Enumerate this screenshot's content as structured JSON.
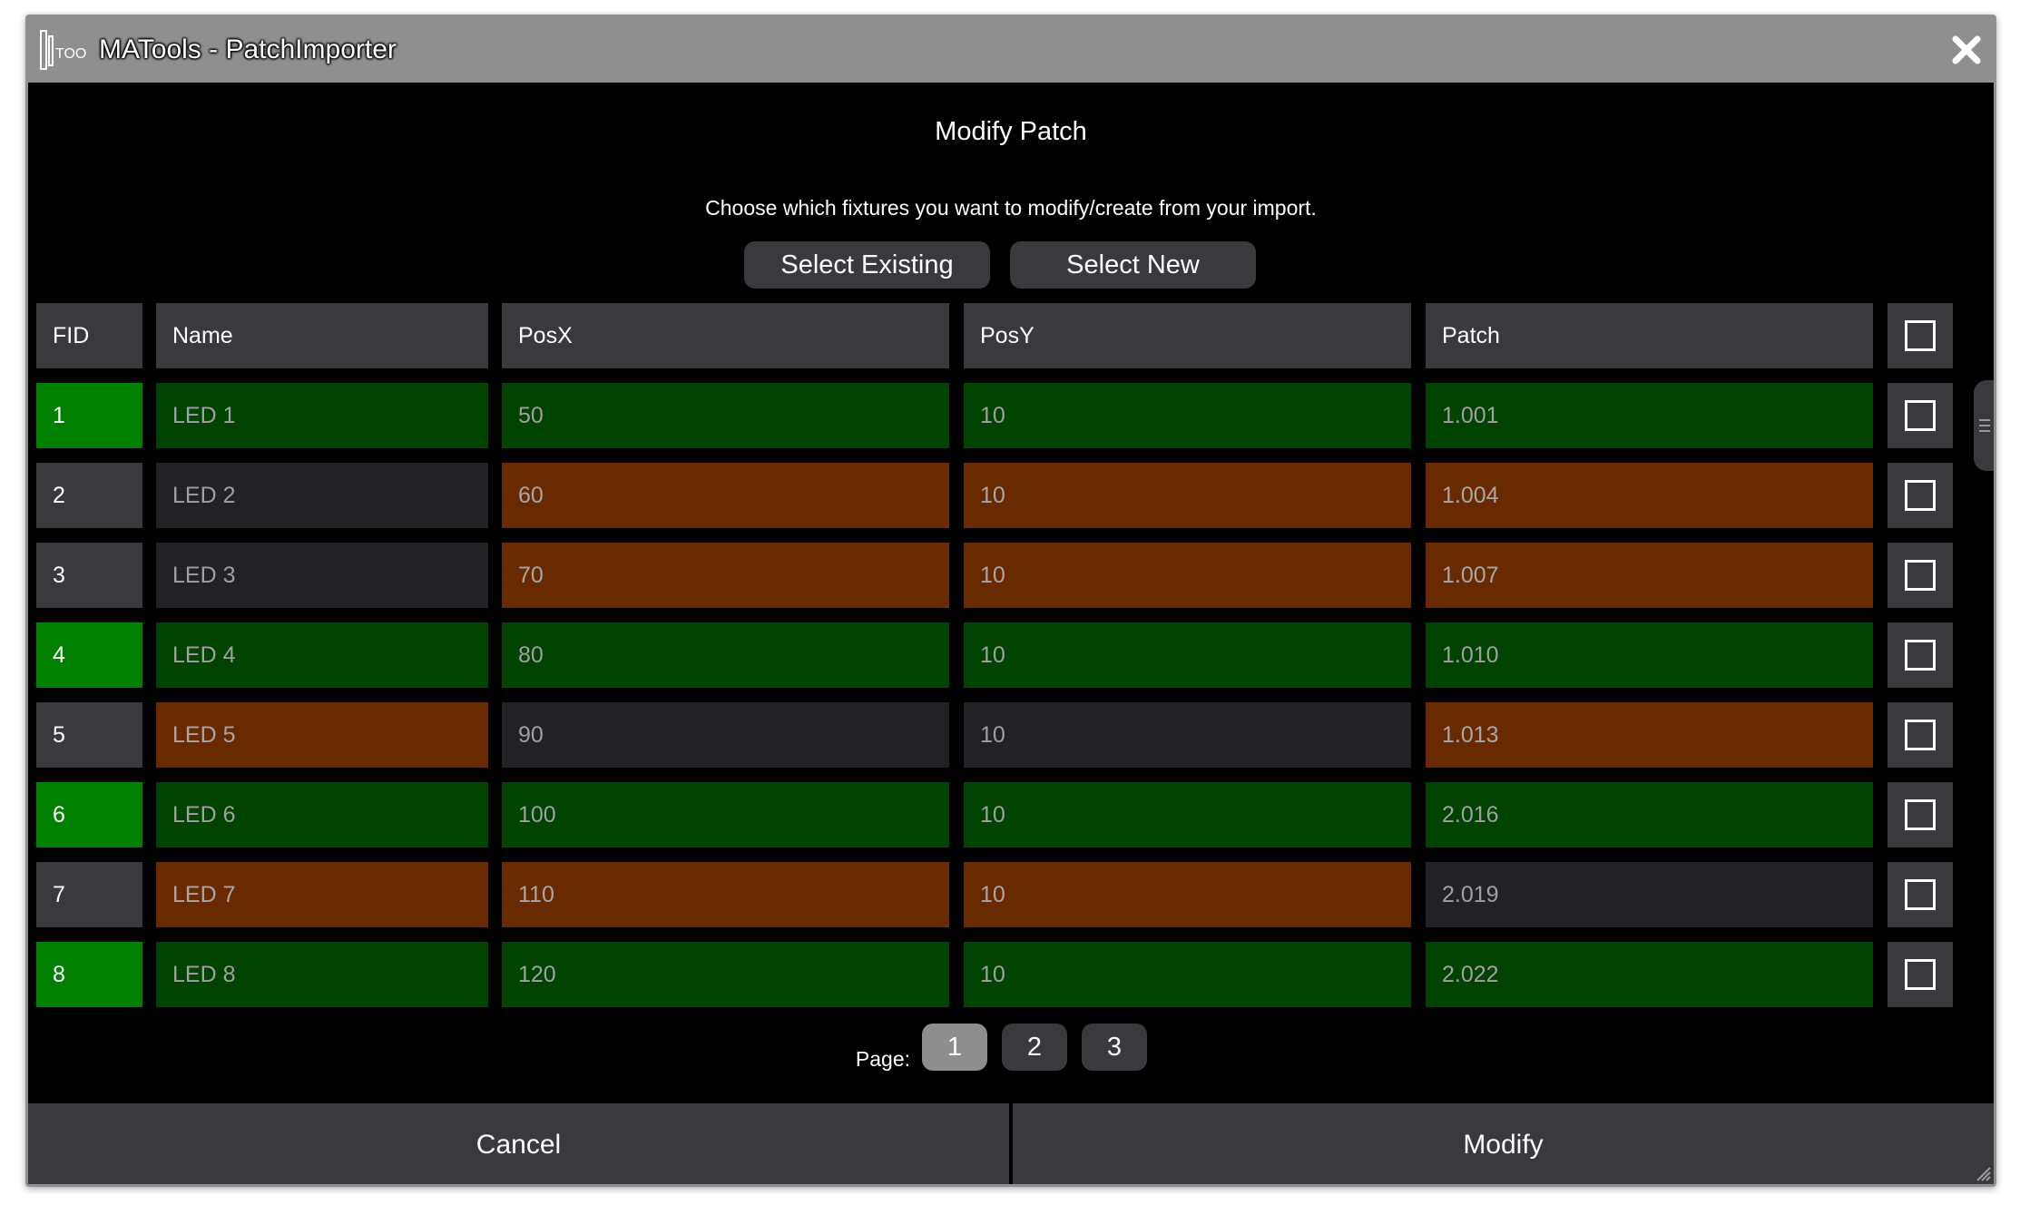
{
  "window": {
    "title": "MATools - PatchImporter"
  },
  "dialog": {
    "title": "Modify Patch",
    "subtitle": "Choose which fixtures you want to modify/create from your import.",
    "select_existing_label": "Select Existing",
    "select_new_label": "Select New"
  },
  "table": {
    "headers": [
      "FID",
      "Name",
      "PosX",
      "PosY",
      "Patch"
    ],
    "rows": [
      {
        "fid": "1",
        "name": "LED 1",
        "posx": "50",
        "posy": "10",
        "patch": "1.001",
        "status": {
          "fid": "new",
          "name": "new",
          "posx": "new",
          "posy": "new",
          "patch": "new"
        }
      },
      {
        "fid": "2",
        "name": "LED 2",
        "posx": "60",
        "posy": "10",
        "patch": "1.004",
        "status": {
          "fid": "existing",
          "name": "same",
          "posx": "changed",
          "posy": "changed",
          "patch": "changed"
        }
      },
      {
        "fid": "3",
        "name": "LED 3",
        "posx": "70",
        "posy": "10",
        "patch": "1.007",
        "status": {
          "fid": "existing",
          "name": "same",
          "posx": "changed",
          "posy": "changed",
          "patch": "changed"
        }
      },
      {
        "fid": "4",
        "name": "LED 4",
        "posx": "80",
        "posy": "10",
        "patch": "1.010",
        "status": {
          "fid": "new",
          "name": "new",
          "posx": "new",
          "posy": "new",
          "patch": "new"
        }
      },
      {
        "fid": "5",
        "name": "LED 5",
        "posx": "90",
        "posy": "10",
        "patch": "1.013",
        "status": {
          "fid": "existing",
          "name": "changed",
          "posx": "same",
          "posy": "same",
          "patch": "changed"
        }
      },
      {
        "fid": "6",
        "name": "LED 6",
        "posx": "100",
        "posy": "10",
        "patch": "2.016",
        "status": {
          "fid": "new",
          "name": "new",
          "posx": "new",
          "posy": "new",
          "patch": "new"
        }
      },
      {
        "fid": "7",
        "name": "LED 7",
        "posx": "110",
        "posy": "10",
        "patch": "2.019",
        "status": {
          "fid": "existing",
          "name": "changed",
          "posx": "changed",
          "posy": "changed",
          "patch": "same"
        }
      },
      {
        "fid": "8",
        "name": "LED 8",
        "posx": "120",
        "posy": "10",
        "patch": "2.022",
        "status": {
          "fid": "new",
          "name": "new",
          "posx": "new",
          "posy": "new",
          "patch": "new"
        }
      }
    ]
  },
  "pagination": {
    "label": "Page:",
    "pages": [
      "1",
      "2",
      "3"
    ],
    "current": "1"
  },
  "footer": {
    "cancel_label": "Cancel",
    "modify_label": "Modify"
  },
  "colors": {
    "fid_new": "#008000",
    "cell_new": "#004200",
    "cell_changed": "#6a2a00",
    "cell_same": "#222226",
    "header_bg": "#3a3a3e",
    "titlebar_bg": "#8f8f8f",
    "page_active": "#8e8e8e"
  },
  "icons": {
    "app_logo": "matools-logo-icon",
    "close": "close-x-icon",
    "checkbox": "checkbox-unchecked-icon",
    "scroll_handle": "scroll-grip-icon",
    "resize": "resize-grip-icon"
  }
}
